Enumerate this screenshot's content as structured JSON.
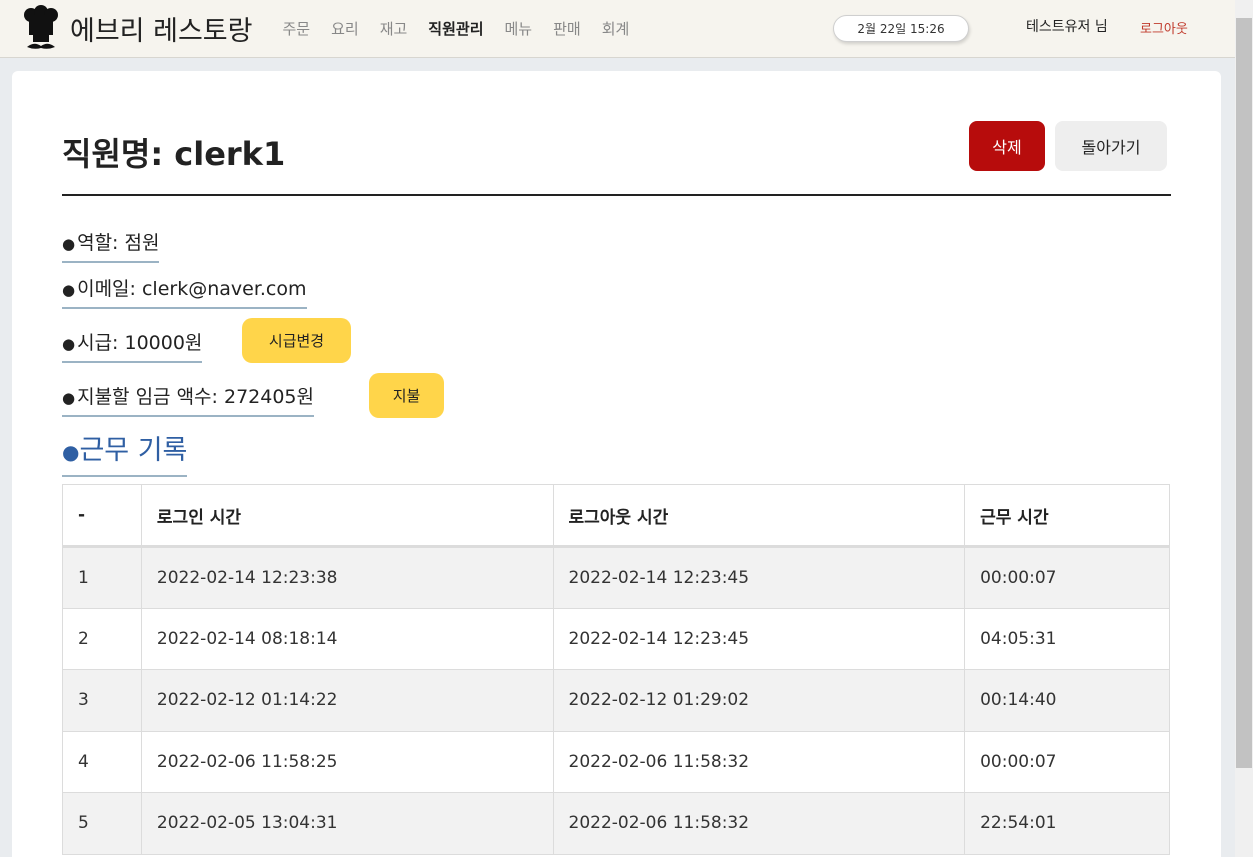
{
  "brand": {
    "title": "에브리 레스토랑"
  },
  "nav": {
    "items": [
      {
        "label": "주문",
        "active": false
      },
      {
        "label": "요리",
        "active": false
      },
      {
        "label": "재고",
        "active": false
      },
      {
        "label": "직원관리",
        "active": true
      },
      {
        "label": "메뉴",
        "active": false
      },
      {
        "label": "판매",
        "active": false
      },
      {
        "label": "회계",
        "active": false
      }
    ],
    "clock": "2월 22일 15:26",
    "user": "테스트유저 님",
    "logout": "로그아웃"
  },
  "page": {
    "title": "직원명: clerk1",
    "delete_label": "삭제",
    "back_label": "돌아가기"
  },
  "info": {
    "bullet": "●",
    "role": "역할: 점원",
    "email": "이메일: clerk@naver.com",
    "wage": "시급: 10000원",
    "wage_button": "시급변경",
    "pay": "지불할 임금 액수: 272405원",
    "pay_button": "지불"
  },
  "records": {
    "title": "근무 기록",
    "headers": [
      "-",
      "로그인 시간",
      "로그아웃 시간",
      "근무 시간"
    ],
    "rows": [
      [
        "1",
        "2022-02-14 12:23:38",
        "2022-02-14 12:23:45",
        "00:00:07"
      ],
      [
        "2",
        "2022-02-14 08:18:14",
        "2022-02-14 12:23:45",
        "04:05:31"
      ],
      [
        "3",
        "2022-02-12 01:14:22",
        "2022-02-12 01:29:02",
        "00:14:40"
      ],
      [
        "4",
        "2022-02-06 11:58:25",
        "2022-02-06 11:58:32",
        "00:00:07"
      ],
      [
        "5",
        "2022-02-05 13:04:31",
        "2022-02-06 11:58:32",
        "22:54:01"
      ]
    ]
  },
  "colors": {
    "delete": "#b70c0c",
    "action_yellow": "#ffd54a",
    "section_blue": "#2f5fa3",
    "logout_red": "#c0392b"
  }
}
